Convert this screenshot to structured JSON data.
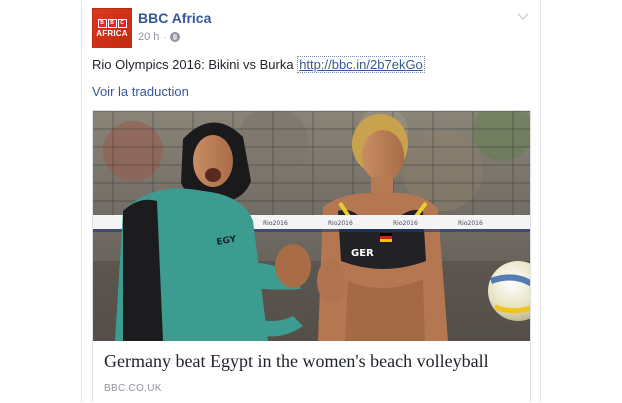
{
  "post": {
    "page_name": "BBC Africa",
    "timestamp": "20 h",
    "dot": "·",
    "text": "Rio Olympics 2016: Bikini vs Burka",
    "link": "http://bbc.in/2b7ekGo",
    "translate_label": "Voir la traduction"
  },
  "avatar": {
    "letters": [
      "B",
      "B",
      "C"
    ],
    "subtitle": "AFRICA"
  },
  "card": {
    "title": "Germany beat Egypt in the women's beach volleyball",
    "source": "BBC.CO.UK",
    "jersey_left": "EGY",
    "jersey_right": "GER",
    "net_logo": "Rio2016"
  },
  "icons": {
    "audience": "globe-icon",
    "options": "chevron-down-icon"
  },
  "colors": {
    "link": "#365899",
    "text": "#1d2129",
    "meta": "#90949c",
    "bbc_red": "#c52a12"
  }
}
